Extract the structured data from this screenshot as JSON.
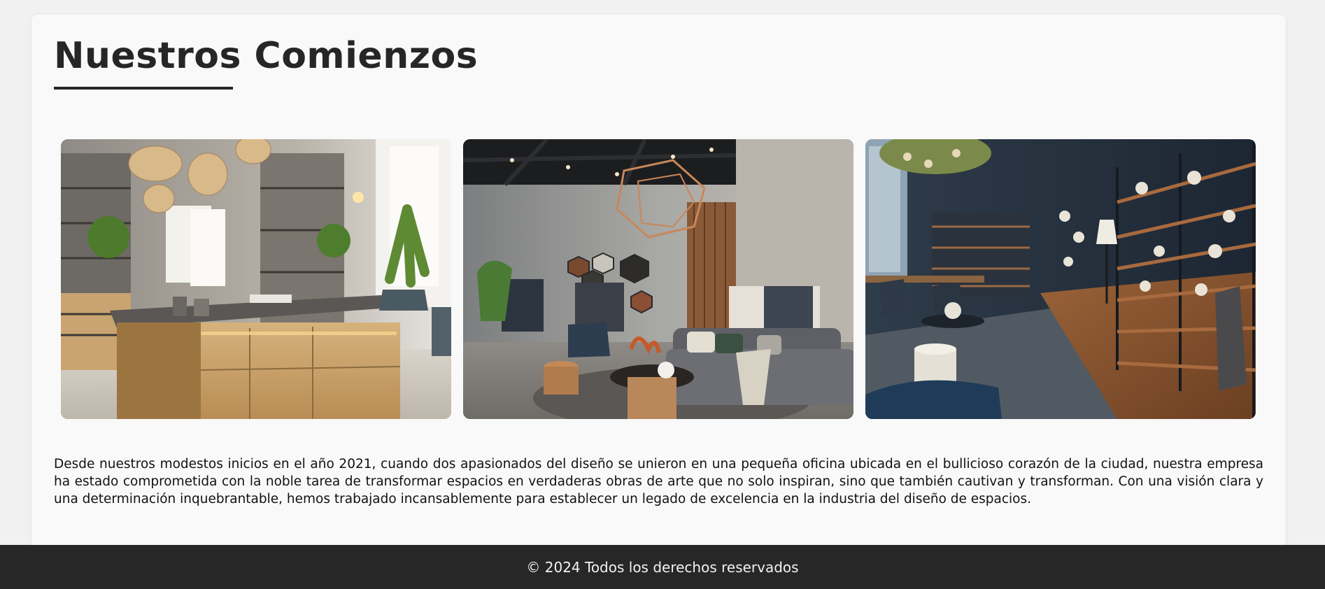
{
  "page": {
    "title": "Nuestros Comienzos",
    "accent_color": "#262626"
  },
  "gallery": {
    "images": [
      {
        "name": "office-showroom-photo",
        "alt": "Oficina con mostrador de madera y estanterías"
      },
      {
        "name": "clothing-showroom-photo",
        "alt": "Tienda de ropa con sofá y lámpara geométrica"
      },
      {
        "name": "decor-store-photo",
        "alt": "Tienda de decoración con estanterías metálicas"
      }
    ]
  },
  "content": {
    "paragraph": "Desde nuestros modestos inicios en el año 2021, cuando dos apasionados del diseño se unieron en una pequeña oficina ubicada en el bullicioso corazón de la ciudad, nuestra empresa ha estado comprometida con la noble tarea de transformar espacios en verdaderas obras de arte que no solo inspiran, sino que también cautivan y transforman. Con una visión clara y una determinación inquebrantable, hemos trabajado incansablemente para establecer un legado de excelencia en la industria del diseño de espacios."
  },
  "footer": {
    "text": "© 2024 Todos los derechos reservados",
    "background": "#272727"
  }
}
